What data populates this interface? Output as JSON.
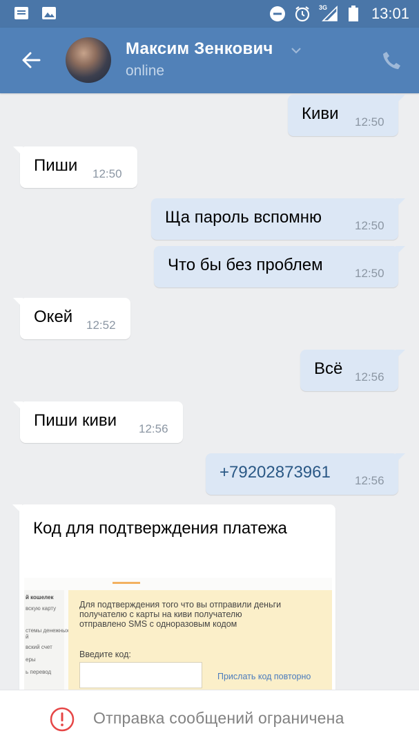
{
  "status_bar": {
    "network": "3G",
    "time": "13:01"
  },
  "header": {
    "contact_name": "Максим Зенкович",
    "status": "online"
  },
  "messages": [
    {
      "direction": "out",
      "text": "Киви",
      "time": "12:50"
    },
    {
      "direction": "in",
      "text": "Пиши",
      "time": "12:50"
    },
    {
      "direction": "out",
      "text": "Ща пароль вспомню",
      "time": "12:50"
    },
    {
      "direction": "out",
      "text": "Что бы без проблем",
      "time": "12:50"
    },
    {
      "direction": "in",
      "text": "Окей",
      "time": "12:52"
    },
    {
      "direction": "out",
      "text": "Всё",
      "time": "12:56"
    },
    {
      "direction": "in",
      "text": "Пиши киви",
      "time": "12:56"
    },
    {
      "direction": "out",
      "text": "+79202873961",
      "time": "12:56"
    },
    {
      "direction": "in",
      "text": "Код для подтверждения платежа",
      "attachment": {
        "sidebar_heading": "й кошелек",
        "sidebar_items": [
          "вскую карту",
          "стемы денежных",
          "й",
          "вский счет",
          "еры",
          "ь перевод"
        ],
        "notice": "Для подтверждения того что вы отправили деньги получателю с карты на киви получателю отправлено SMS с одноразовым кодом",
        "code_label": "Введите код:",
        "resend_link": "Прислать код повторно"
      }
    }
  ],
  "bottom_bar": {
    "notice": "Отправка сообщений ограничена"
  },
  "colors": {
    "header": "#5181b8",
    "statusbar": "#4a76a8",
    "chat_bg": "#edeef0",
    "incoming": "#ffffff",
    "outgoing": "#dce7f5",
    "warning": "#e64646"
  }
}
